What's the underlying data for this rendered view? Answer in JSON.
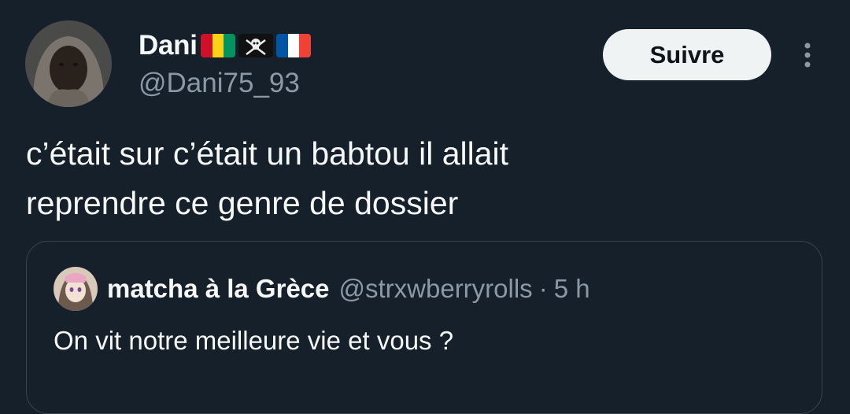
{
  "author": {
    "display_name": "Dani",
    "handle": "@Dani75_93",
    "flags": [
      "guinea-flag-icon",
      "pirate-flag-icon",
      "france-flag-icon"
    ]
  },
  "follow_button": {
    "label": "Suivre"
  },
  "tweet": {
    "lines": [
      "c’était sur c’était un babtou il allait",
      "reprendre ce genre de dossier"
    ]
  },
  "quoted_tweet": {
    "display_name": "matcha à la Grèce",
    "handle": "@strxwberryrolls",
    "separator": "·",
    "time": "5 h",
    "text": "On vit notre meilleure vie et vous ?"
  },
  "colors": {
    "background": "#15202b",
    "text_primary": "#f7f9f9",
    "text_secondary": "#8b98a5",
    "border": "#38444d",
    "button_bg": "#eff3f4",
    "button_text": "#0f1419"
  }
}
